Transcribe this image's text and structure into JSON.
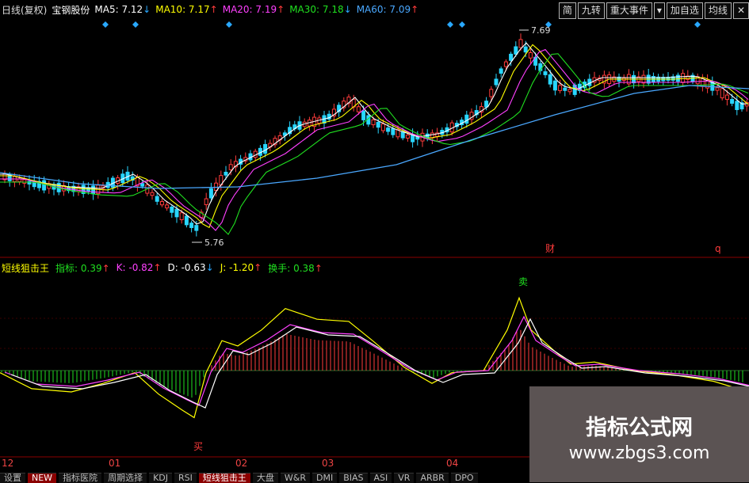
{
  "header": {
    "chart_mode": "日线(复权)",
    "stock_name": "宝钢股份",
    "ma_items": [
      {
        "label": "MA5: 7.12",
        "color": "#ffffff",
        "arrow": "↓",
        "arrow_dir": "down"
      },
      {
        "label": "MA10: 7.17",
        "color": "#ffff00",
        "arrow": "↑",
        "arrow_dir": "up"
      },
      {
        "label": "MA20: 7.19",
        "color": "#ff40ff",
        "arrow": "↑",
        "arrow_dir": "up"
      },
      {
        "label": "MA30: 7.18",
        "color": "#20e020",
        "arrow": "↓",
        "arrow_dir": "down"
      },
      {
        "label": "MA60: 7.09",
        "color": "#4aa8ff",
        "arrow": "↑",
        "arrow_dir": "up"
      }
    ]
  },
  "toolbar": {
    "buttons": [
      "简",
      "九转",
      "重大事件",
      "加自选",
      "均线"
    ],
    "menu_icon": "dropdown-arrow-icon",
    "close_icon": "close-icon"
  },
  "price_chart": {
    "high_marker": "7.69",
    "low_marker": "5.76",
    "event_marks": [
      "财",
      "q"
    ]
  },
  "indicator": {
    "name": "短线狙击王",
    "items": [
      {
        "label": "指标: 0.39",
        "color": "#20e020",
        "arrow": "↑",
        "arrow_dir": "up"
      },
      {
        "label": "K: -0.82",
        "color": "#ff40ff",
        "arrow": "↑",
        "arrow_dir": "up"
      },
      {
        "label": "D: -0.63",
        "color": "#ffffff",
        "arrow": "↓",
        "arrow_dir": "down"
      },
      {
        "label": "J: -1.20",
        "color": "#ffff00",
        "arrow": "↑",
        "arrow_dir": "up"
      },
      {
        "label": "换手: 0.38",
        "color": "#20e020",
        "arrow": "↑",
        "arrow_dir": "up"
      }
    ],
    "sell_signal": "卖",
    "buy_signal": "买"
  },
  "date_axis": [
    "12",
    "01",
    "02",
    "03",
    "04"
  ],
  "bottom_tabs": [
    {
      "label": "设置",
      "active": false
    },
    {
      "label": "NEW",
      "active": true
    },
    {
      "label": "指标医院",
      "active": false
    },
    {
      "label": "周期选择",
      "active": false
    },
    {
      "label": "KDJ",
      "active": false
    },
    {
      "label": "RSI",
      "active": false
    },
    {
      "label": "短线狙击王",
      "active": true
    },
    {
      "label": "大盘",
      "active": false
    },
    {
      "label": "W&R",
      "active": false
    },
    {
      "label": "DMI",
      "active": false
    },
    {
      "label": "BIAS",
      "active": false
    },
    {
      "label": "ASI",
      "active": false
    },
    {
      "label": "VR",
      "active": false
    },
    {
      "label": "ARBR",
      "active": false
    },
    {
      "label": "DPO",
      "active": false
    }
  ],
  "watermark": {
    "title": "指标公式网",
    "url": "www.zbgs3.com"
  }
}
